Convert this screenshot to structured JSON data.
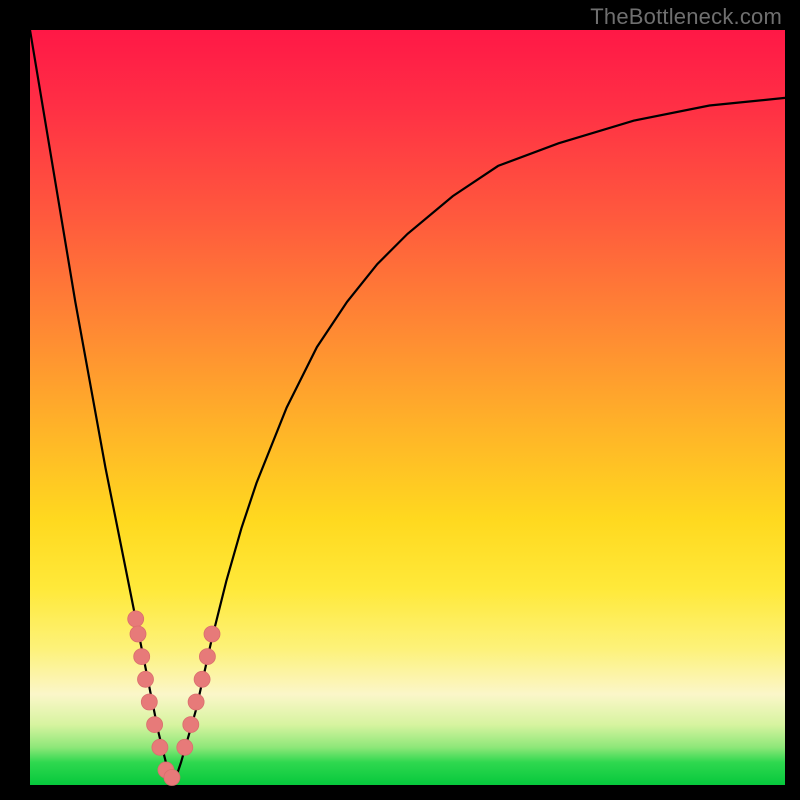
{
  "watermark": "TheBottleneck.com",
  "colors": {
    "frame": "#000000",
    "curve": "#000000",
    "marker": "#e77a79",
    "gradient_top": "#ff1846",
    "gradient_bottom": "#06c83c"
  },
  "chart_data": {
    "type": "line",
    "title": "",
    "xlabel": "",
    "ylabel": "",
    "xlim": [
      0,
      100
    ],
    "ylim": [
      0,
      100
    ],
    "x": [
      0,
      2,
      4,
      6,
      8,
      10,
      12,
      14,
      15,
      16,
      17,
      18,
      19,
      20,
      22,
      24,
      26,
      28,
      30,
      34,
      38,
      42,
      46,
      50,
      56,
      62,
      70,
      80,
      90,
      100
    ],
    "values": [
      100,
      88,
      76,
      64,
      53,
      42,
      32,
      22,
      17,
      12,
      7,
      3,
      0,
      3,
      10,
      19,
      27,
      34,
      40,
      50,
      58,
      64,
      69,
      73,
      78,
      82,
      85,
      88,
      90,
      91
    ],
    "series": [
      {
        "name": "bottleneck-curve",
        "x": [
          0,
          2,
          4,
          6,
          8,
          10,
          12,
          14,
          15,
          16,
          17,
          18,
          19,
          20,
          22,
          24,
          26,
          28,
          30,
          34,
          38,
          42,
          46,
          50,
          56,
          62,
          70,
          80,
          90,
          100
        ],
        "values": [
          100,
          88,
          76,
          64,
          53,
          42,
          32,
          22,
          17,
          12,
          7,
          3,
          0,
          3,
          10,
          19,
          27,
          34,
          40,
          50,
          58,
          64,
          69,
          73,
          78,
          82,
          85,
          88,
          90,
          91
        ]
      }
    ],
    "markers": {
      "name": "highlight-points",
      "x": [
        14.0,
        14.3,
        14.8,
        15.3,
        15.8,
        16.5,
        17.2,
        18.0,
        18.8,
        20.5,
        21.3,
        22.0,
        22.8,
        23.5,
        24.1
      ],
      "y": [
        22,
        20,
        17,
        14,
        11,
        8,
        5,
        2,
        1,
        5,
        8,
        11,
        14,
        17,
        20
      ]
    }
  }
}
